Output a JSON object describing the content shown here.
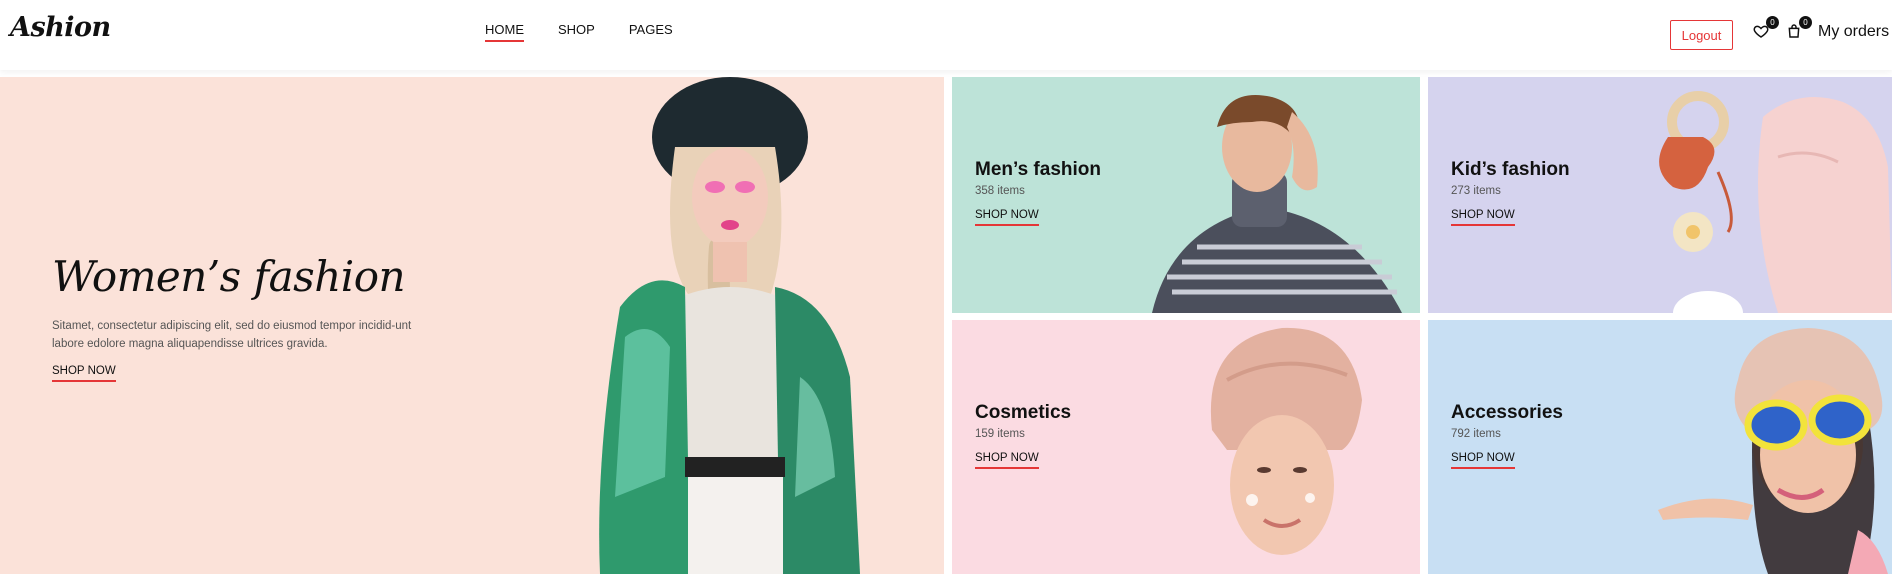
{
  "header": {
    "logo": "Ashion",
    "nav": [
      {
        "label": "HOME",
        "active": true
      },
      {
        "label": "SHOP",
        "active": false
      },
      {
        "label": "PAGES",
        "active": false
      }
    ],
    "logout_label": "Logout",
    "wishlist_count": "0",
    "cart_count": "0",
    "orders_label": "My orders"
  },
  "hero": {
    "title": "Women’s fashion",
    "description": "Sitamet, consectetur adipiscing elit, sed do eiusmod tempor incidid-unt labore edolore magna aliquapendisse ultrices gravida.",
    "shop_label": "SHOP NOW"
  },
  "categories": [
    {
      "title": "Men’s fashion",
      "count": "358 items",
      "shop_label": "SHOP NOW"
    },
    {
      "title": "Kid’s fashion",
      "count": "273 items",
      "shop_label": "SHOP NOW"
    },
    {
      "title": "Cosmetics",
      "count": "159 items",
      "shop_label": "SHOP NOW"
    },
    {
      "title": "Accessories",
      "count": "792 items",
      "shop_label": "SHOP NOW"
    }
  ],
  "colors": {
    "accent": "#e53637",
    "women_bg": "#fbe2d9",
    "men_bg": "#bde3d8",
    "kids_bg": "#d5d3ee",
    "cosmetics_bg": "#fbdbe2",
    "accessories_bg": "#c8dff3"
  },
  "icons": {
    "wishlist": "heart-icon",
    "cart": "shopping-bag-icon"
  }
}
